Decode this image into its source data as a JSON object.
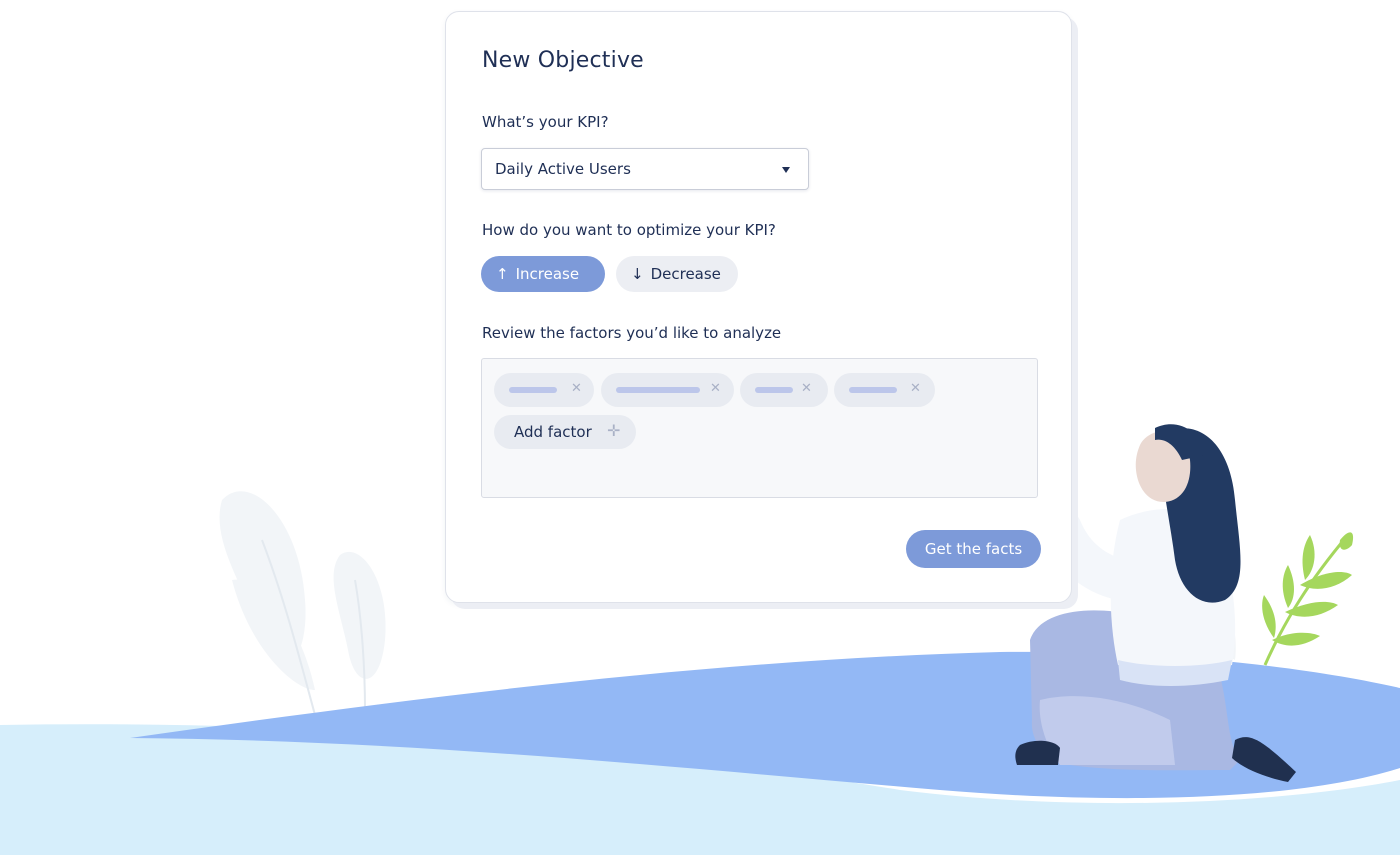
{
  "form": {
    "title": "New Objective",
    "kpi_label": "What’s your KPI?",
    "kpi_value": "Daily Active Users",
    "optimize_label": "How do you want to optimize your KPI?",
    "increase": {
      "label": "Increase",
      "icon": "↑"
    },
    "decrease": {
      "label": "Decrease",
      "icon": "↓"
    },
    "factors_label": "Review the factors you’d like to analyze",
    "add_factor": {
      "label": "Add factor",
      "icon": "✛"
    },
    "chip_remove_icon": "✕",
    "submit_label": "Get the facts"
  },
  "colors": {
    "primary": "#7d9ad9",
    "text": "#1f2f55",
    "ground": "#93b8f5",
    "ground_light": "#d6eefb",
    "hair": "#223a62",
    "leaf": "#a5d75d"
  }
}
